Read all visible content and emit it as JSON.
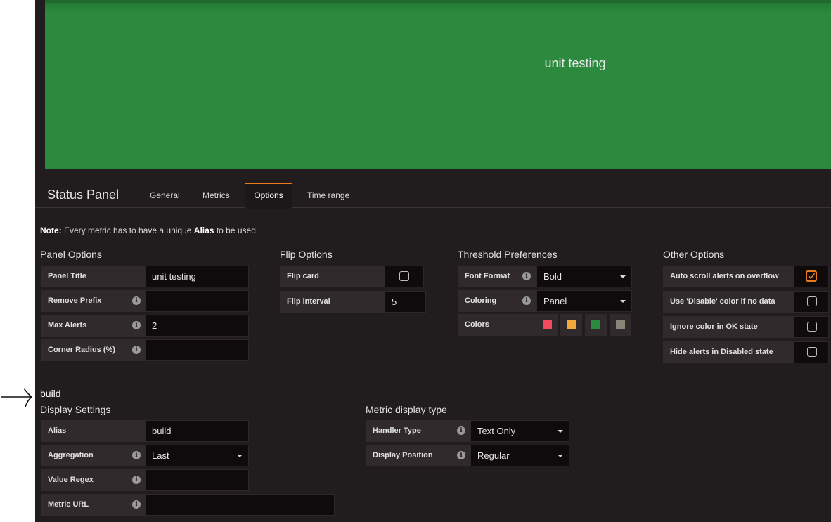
{
  "panel_preview": {
    "text": "unit testing",
    "color": "#2b8a3d"
  },
  "header": {
    "title": "Status Panel",
    "tabs": [
      {
        "label": "General"
      },
      {
        "label": "Metrics"
      },
      {
        "label": "Options"
      },
      {
        "label": "Time range"
      }
    ],
    "active_tab": "Options"
  },
  "note": {
    "prefix": "Note:",
    "text1": "Every metric has to have a unique",
    "alias": "Alias",
    "text2": "to be used"
  },
  "panel_options": {
    "heading": "Panel Options",
    "panel_title": {
      "label": "Panel Title",
      "value": "unit testing"
    },
    "remove_prefix": {
      "label": "Remove Prefix",
      "value": ""
    },
    "max_alerts": {
      "label": "Max Alerts",
      "value": "2"
    },
    "corner_radius": {
      "label": "Corner Radius (%)",
      "value": ""
    }
  },
  "flip_options": {
    "heading": "Flip Options",
    "flip_card": {
      "label": "Flip card",
      "checked": false
    },
    "flip_interval": {
      "label": "Flip interval",
      "value": "5"
    }
  },
  "threshold": {
    "heading": "Threshold Preferences",
    "font_format": {
      "label": "Font Format",
      "value": "Bold"
    },
    "coloring": {
      "label": "Coloring",
      "value": "Panel"
    },
    "colors": {
      "label": "Colors",
      "swatches": [
        "#f2495c",
        "#f2a93b",
        "#2b8a3d",
        "#8a8478"
      ]
    }
  },
  "other_options": {
    "heading": "Other Options",
    "items": [
      {
        "label": "Auto scroll alerts on overflow",
        "checked": true
      },
      {
        "label": "Use 'Disable' color if no data",
        "checked": false
      },
      {
        "label": "Ignore color in OK state",
        "checked": false
      },
      {
        "label": "Hide alerts in Disabled state",
        "checked": false
      }
    ]
  },
  "metric_name": "build",
  "display_settings": {
    "heading": "Display Settings",
    "alias": {
      "label": "Alias",
      "value": "build"
    },
    "aggregation": {
      "label": "Aggregation",
      "value": "Last"
    },
    "value_regex": {
      "label": "Value Regex",
      "value": ""
    },
    "metric_url": {
      "label": "Metric URL",
      "value": ""
    }
  },
  "metric_display": {
    "heading": "Metric display type",
    "handler_type": {
      "label": "Handler Type",
      "value": "Text Only"
    },
    "display_position": {
      "label": "Display Position",
      "value": "Regular"
    }
  },
  "accent_color": "#eb7b18"
}
